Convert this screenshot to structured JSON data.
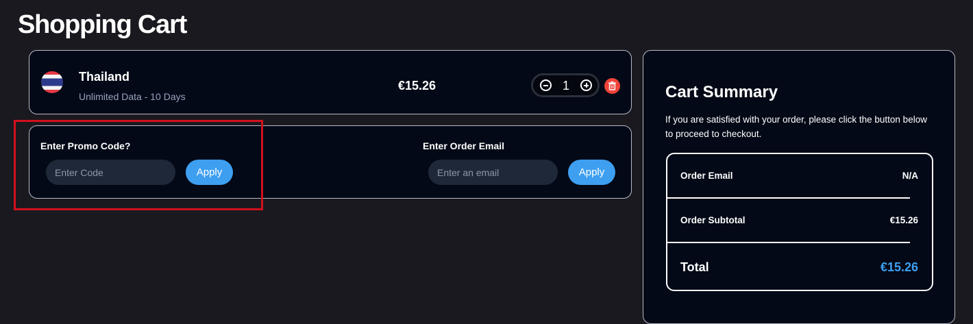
{
  "page": {
    "title": "Shopping Cart"
  },
  "cart_item": {
    "name": "Thailand",
    "description": "Unlimited Data - 10 Days",
    "price": "€15.26",
    "quantity": "1",
    "flag_icon": "thailand-flag-icon",
    "delete_icon": "trash-icon"
  },
  "promo": {
    "label": "Enter Promo Code?",
    "placeholder": "Enter Code",
    "button_label": "Apply"
  },
  "email": {
    "label": "Enter Order Email",
    "placeholder": "Enter an email",
    "button_label": "Apply"
  },
  "summary": {
    "title": "Cart Summary",
    "description": "If you are satisfied with your order, please click the button below to proceed to checkout.",
    "rows": [
      {
        "label": "Order Email",
        "value": "N/A"
      },
      {
        "label": "Order Subtotal",
        "value": "€15.26"
      }
    ],
    "total_label": "Total",
    "total_value": "€15.26"
  },
  "colors": {
    "background": "#1a191f",
    "card": "#030916",
    "accent": "#3e9ff1",
    "danger": "#f0433a",
    "highlight": "#d1101c"
  }
}
